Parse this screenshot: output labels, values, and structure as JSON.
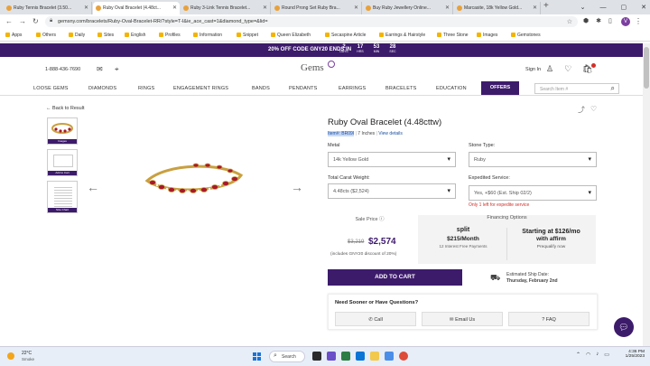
{
  "browser": {
    "tabs": [
      {
        "label": "Ruby Tennis Bracelet (3.50...",
        "active": false
      },
      {
        "label": "Ruby Oval Bracelet (4.48ct...",
        "active": true
      },
      {
        "label": "Ruby 3-Link Tennis Bracelet...",
        "active": false
      },
      {
        "label": "Round Prong Set Ruby Bra...",
        "active": false
      },
      {
        "label": "Buy Ruby Jewellery Online...",
        "active": false
      },
      {
        "label": "Marcasite, 18k Yellow Gold...",
        "active": false
      }
    ],
    "new_tab": "+",
    "url": "gemsny.com/bracelets/Ruby-Oval-Bracelet-RR/?style=T-I&ie_ace_cast=1&diamond_type=&lid=",
    "profile_initial": "V",
    "bookmarks": [
      "Apps",
      "Others",
      "Daily",
      "Sites",
      "English",
      "Profiles",
      "Information",
      "Snippet",
      "Queen Elizabeth",
      "Secaspine Article",
      "Earrings & Hairstyle",
      "Three Stone",
      "Images",
      "Gemstones"
    ]
  },
  "promo": {
    "text": "20% OFF CODE GNY20 ENDS IN",
    "countdown": [
      {
        "num": "2",
        "unit": "DAYS"
      },
      {
        "num": "17",
        "unit": "HRS"
      },
      {
        "num": "53",
        "unit": "MIN"
      },
      {
        "num": "28",
        "unit": "SEC"
      }
    ]
  },
  "header": {
    "phone": "1-888-436-7690",
    "logo": "Gems",
    "signin": "Sign In"
  },
  "nav": {
    "items": [
      "LOOSE GEMS",
      "DIAMONDS",
      "RINGS",
      "ENGAGEMENT RINGS",
      "BANDS",
      "PENDANTS",
      "EARRINGS",
      "BRACELETS",
      "EDUCATION"
    ],
    "offers": "OFFERS",
    "search_placeholder": "Search Item #"
  },
  "product": {
    "back": "Back to Result",
    "thumbs": [
      "Images",
      "Add to Cart",
      "Size Chart"
    ],
    "title": "Ruby Oval Bracelet (4.48cttw)",
    "sku": "Item#: BR09I",
    "length": "7 Inches",
    "details_link": "View details",
    "metal_label": "Metal",
    "metal_value": "14k Yellow Gold",
    "stone_label": "Stone Type:",
    "stone_value": "Ruby",
    "carat_label": "Total Carat Weight:",
    "carat_value": "4.48cts ($2,524)",
    "expedited_label": "Expedited Service:",
    "expedited_value": "Yes, +$60 (Est. Ship 02/2)",
    "expedite_note": "Only 1 left for expedite service",
    "sale_label": "Sale Price",
    "old_price": "$3,219",
    "price": "$2,574",
    "price_note": "(includes GNY20 discount of 20%)",
    "financing_label": "Financing Options",
    "splitit_logo": "split",
    "splitit_amount": "$215/Month",
    "splitit_sub": "12 Interest Free Payments",
    "affirm_amount": "Starting at $126/mo",
    "affirm_with": "with affirm",
    "affirm_prequalify": "Prequalify now",
    "add_to_cart": "ADD TO CART",
    "ship_label": "Estimated Ship Date:",
    "ship_date": "Thursday, February 2nd",
    "help_title": "Need Sooner or Have Questions?",
    "help_call": "Call",
    "help_email": "Email Us",
    "help_faq": "FAQ"
  },
  "taskbar": {
    "temp": "22°C",
    "condition": "Smoke",
    "search": "Search",
    "time": "4:36 PM",
    "date": "1/25/2023"
  },
  "colors": {
    "brand_purple": "#3d1b6b",
    "alert_red": "#d0302a"
  }
}
